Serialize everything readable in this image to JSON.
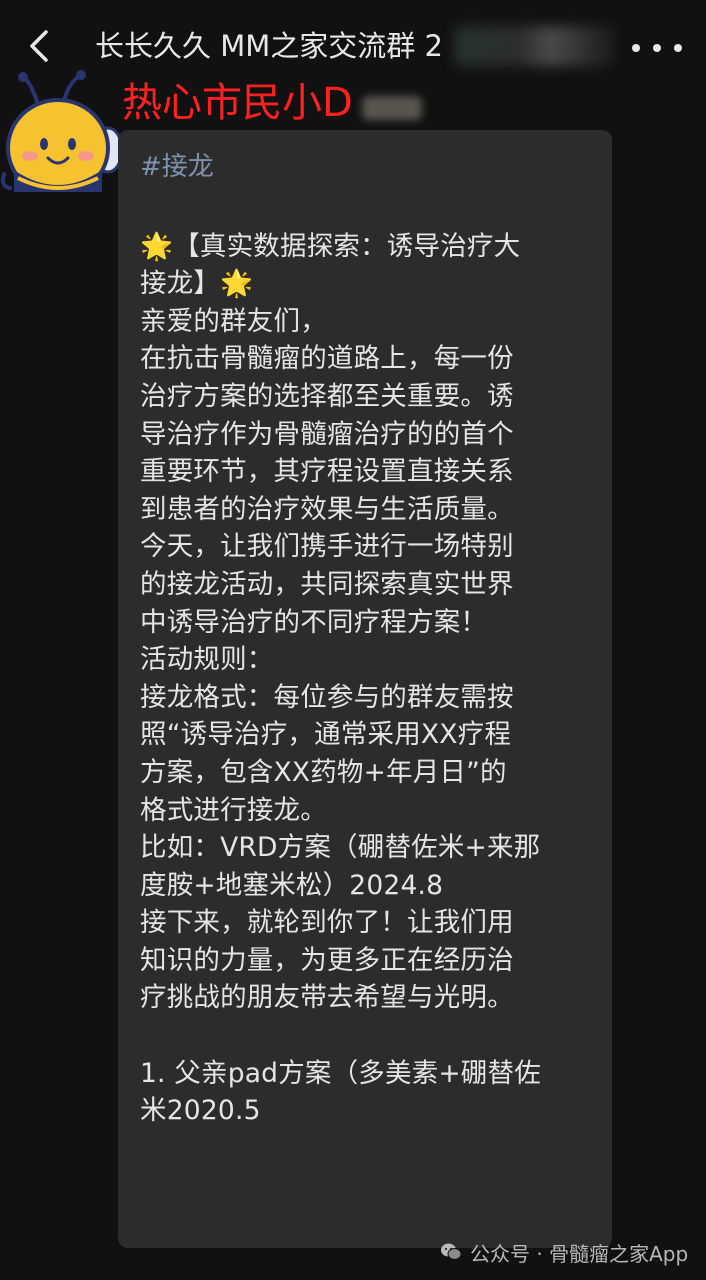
{
  "header": {
    "title": "长长久久 MM之家交流群 2"
  },
  "sender": {
    "name": "热心市民小D"
  },
  "message": {
    "hashtag": "#接龙",
    "lines": [
      "🌟【真实数据探索：诱导治疗大",
      "接龙】🌟",
      "亲爱的群友们，",
      "在抗击骨髓瘤的道路上，每一份",
      "治疗方案的选择都至关重要。诱",
      "导治疗作为骨髓瘤治疗的的首个",
      "重要环节，其疗程设置直接关系",
      "到患者的治疗效果与生活质量。",
      "今天，让我们携手进行一场特别",
      "的接龙活动，共同探索真实世界",
      "中诱导治疗的不同疗程方案！",
      "活动规则：",
      "接龙格式：每位参与的群友需按",
      "照“诱导治疗，通常采用XX疗程",
      "方案，包含XX药物+年月日”的",
      "格式进行接龙。",
      "比如：VRD方案（硼替佐米+来那",
      "度胺+地塞米松）2024.8",
      "接下来，就轮到你了！让我们用",
      "知识的力量，为更多正在经历治",
      "疗挑战的朋友带去希望与光明。"
    ],
    "entry_lines": [
      "1. 父亲pad方案（多美素+硼替佐",
      "米2020.5"
    ]
  },
  "watermark": {
    "text": "公众号 · 骨髓瘤之家App"
  },
  "colors": {
    "background": "#111111",
    "bubble": "#2c2c2c",
    "sender_name": "#ff2020",
    "hashtag": "#7e93ad",
    "text": "#e5e5e5"
  }
}
